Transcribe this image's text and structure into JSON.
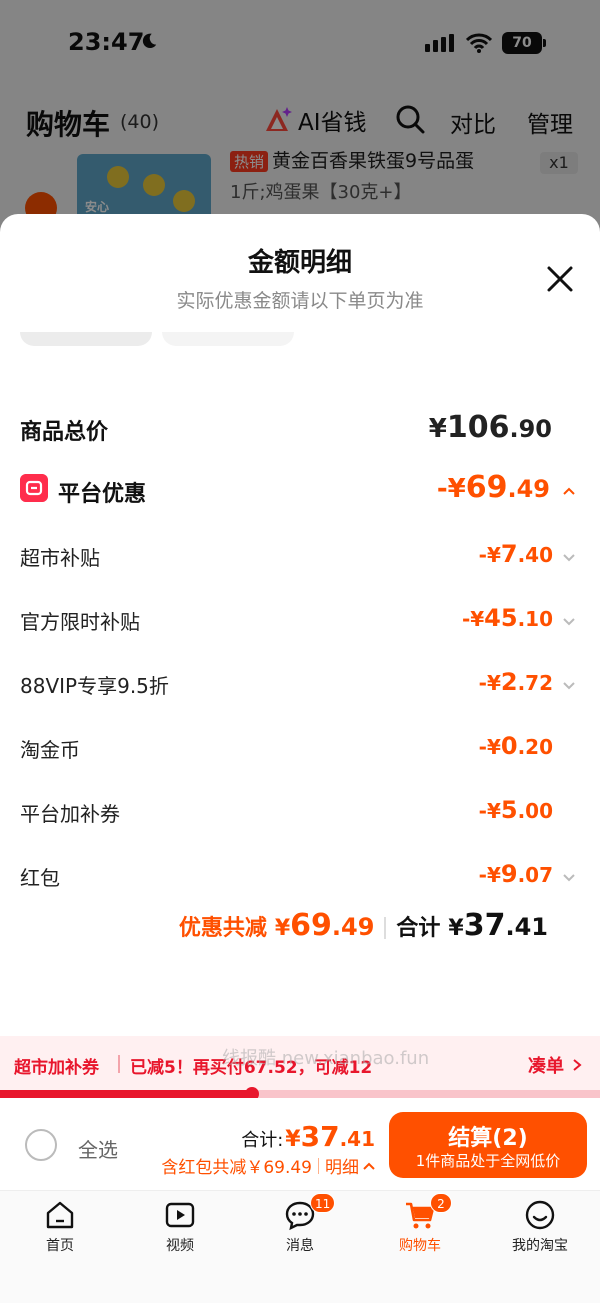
{
  "status_bar": {
    "time": "23:47",
    "battery": "70"
  },
  "header": {
    "title": "购物车",
    "count": "(40)",
    "ai_label": "AI省钱",
    "compare_label": "对比",
    "manage_label": "管理"
  },
  "cart_item": {
    "hot_tag": "热销",
    "title": "黄金百香果铁蛋9号品蛋",
    "spec": "1斤;鸡蛋果【30克+】",
    "qty": "x1",
    "thumb_tag": "安心"
  },
  "sheet": {
    "title": "金额明细",
    "subtitle": "实际优惠金额请以下单页为准",
    "total": {
      "label": "商品总价",
      "currency": "¥",
      "int": "106",
      "dec": ".90"
    },
    "platform": {
      "label": "平台优惠",
      "sign": "-¥",
      "int": "69",
      "dec": ".49"
    },
    "items": [
      {
        "label": "超市补贴",
        "sign": "-¥",
        "int": "7",
        "dec": ".40",
        "chevron": true
      },
      {
        "label": "官方限时补贴",
        "sign": "-¥",
        "int": "45",
        "dec": ".10",
        "chevron": true
      },
      {
        "label": "88VIP专享9.5折",
        "sign": "-¥",
        "int": "2",
        "dec": ".72",
        "chevron": true
      },
      {
        "label": "淘金币",
        "sign": "-¥",
        "int": "0",
        "dec": ".20",
        "chevron": false
      },
      {
        "label": "平台加补券",
        "sign": "-¥",
        "int": "5",
        "dec": ".00",
        "chevron": false
      },
      {
        "label": "红包",
        "sign": "-¥",
        "int": "9",
        "dec": ".07",
        "chevron": true
      }
    ],
    "summary": {
      "discount_label": "优惠共减",
      "discount_currency": "¥",
      "discount_int": "69",
      "discount_dec": ".49",
      "total_label": "合计",
      "total_currency": "¥",
      "total_int": "37",
      "total_dec": ".41"
    }
  },
  "coupon_strip": {
    "title": "超市加补券",
    "text": "已减5！再买付67.52，可减12",
    "link": "凑单",
    "progress": 0.42
  },
  "watermark": "线报酷 new.xianbao.fun",
  "checkout": {
    "select_all": "全选",
    "total_label": "合计:",
    "currency": "¥",
    "total_int": "37",
    "total_dec": ".41",
    "sub_text": "含红包共减￥69.49",
    "detail_label": "明细",
    "pay_label": "结算(2)",
    "pay_sub": "1件商品处于全网低价"
  },
  "tabs": [
    {
      "label": "首页",
      "icon": "home-icon"
    },
    {
      "label": "视频",
      "icon": "video-icon"
    },
    {
      "label": "消息",
      "icon": "message-icon",
      "badge": "11"
    },
    {
      "label": "购物车",
      "icon": "cart-icon",
      "badge": "2",
      "active": true
    },
    {
      "label": "我的淘宝",
      "icon": "profile-icon"
    }
  ],
  "colors": {
    "accent": "#ff5000",
    "red": "#e8162c"
  }
}
